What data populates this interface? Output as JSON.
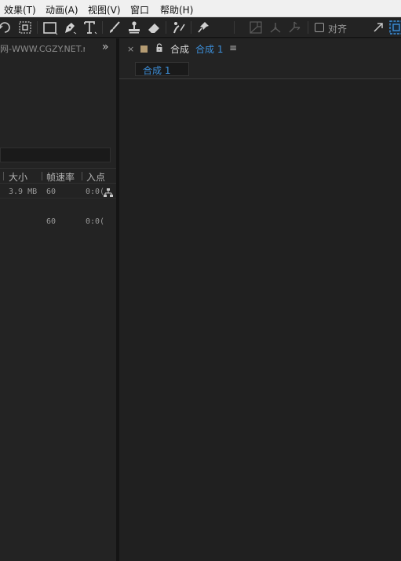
{
  "menubar": {
    "items": [
      {
        "label": "效果(T)"
      },
      {
        "label": "动画(A)"
      },
      {
        "label": "视图(V)"
      },
      {
        "label": "窗口"
      },
      {
        "label": "帮助(H)"
      }
    ]
  },
  "toolbar": {
    "tools": [
      "rotate-tool-icon",
      "camera-orbit-tool-icon",
      "rectangle-tool-icon",
      "pen-tool-icon",
      "type-tool-icon",
      "brush-tool-icon",
      "clone-stamp-tool-icon",
      "eraser-tool-icon",
      "roto-brush-tool-icon",
      "puppet-pin-tool-icon",
      "axis-local-icon",
      "axis-world-icon",
      "axis-view-icon",
      "expand-icon",
      "workspace-icon"
    ],
    "snap_label": "对齐"
  },
  "project_panel": {
    "title": "网-WWW.CGZY.NET.m",
    "columns": [
      "大小",
      "帧速率",
      "入点"
    ],
    "rows": [
      {
        "size": "3.9 MB",
        "fps": "60",
        "in": "0:0("
      },
      {
        "size": "",
        "fps": "60",
        "in": "0:0("
      }
    ]
  },
  "composition_panel": {
    "label": "合成",
    "name": "合成 1",
    "tab": "合成 1",
    "swatch_color": "#b59c73",
    "accent_color": "#3d8fd9"
  }
}
